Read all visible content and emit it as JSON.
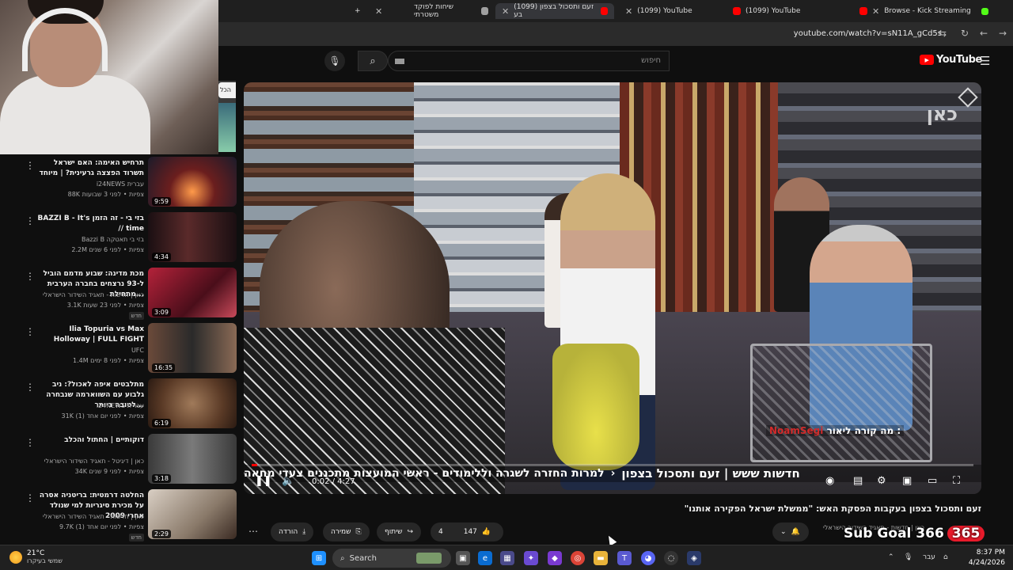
{
  "browser": {
    "tabs": [
      {
        "label": "שיחות לפוקד משטרתי",
        "fav_color": "#a0a0a0"
      },
      {
        "label": "(1099) זעם ותסכול בצפון בע",
        "fav_color": "#ff0000"
      },
      {
        "label": "(1099) YouTube",
        "fav_color": "#ff0000"
      },
      {
        "label": "(1099) YouTube",
        "fav_color": "#ff0000"
      },
      {
        "label": "Browse - Kick Streaming",
        "fav_color": "#53fc18"
      }
    ],
    "new_tab": "+",
    "url": "youtube.com/watch?v=sN11A_gCd5s"
  },
  "youtube": {
    "search_placeholder": "חיפוש",
    "logo_text": "YouTube",
    "chip_label": "הכל",
    "recommendations": [
      {
        "title": "תרחיש האימה: האם ישראל תשרוד הפצצה גרעינית? | מיוחד",
        "channel": "i24NEWS עברית",
        "meta": "88K צפיות • לפני 3 שבועות",
        "duration": "9:59",
        "new": "",
        "thumb": "#6b1e1e"
      },
      {
        "title": "BAZZI B - It's בזי בי - זה הזמן // time",
        "channel": "Bazzi B בזי בי תאטקה",
        "meta": "2.2M צפיות • לפני 6 שנים",
        "duration": "4:34",
        "new": "",
        "thumb": "#2a1418"
      },
      {
        "title": "מכת מדינה: שבוע מדמם הוביל ל-93 נרצחים בחברה הערבית מתחילת...",
        "channel": "כאן | חדשות - תאגיד השידור הישראלי",
        "meta": "3.1K צפיות • לפני 23 שעות",
        "duration": "3:09",
        "new": "חדש",
        "thumb": "#8a1b2b"
      },
      {
        "title": "Ilia Topuria vs Max Holloway | FULL FIGHT",
        "channel": "UFC",
        "meta": "1.4M צפיות • לפני 8 ימים",
        "duration": "16:35",
        "new": "",
        "thumb": "#4a4036"
      },
      {
        "title": "מתלבטים איפה לאכול?: ניב גלבוע עם השווארמה שנבחרה לטובה ביותר...",
        "channel": "i24NEWS עברית",
        "meta": "31K צפיות • לפני יום אחד (1)",
        "duration": "6:19",
        "new": "",
        "thumb": "#6b4a34"
      },
      {
        "title": "דוקותיים | החתול והכלב",
        "channel": "כאן | דיגיטל - תאגיד השידור הישראלי",
        "meta": "34K צפיות • לפני 9 שנים",
        "duration": "3:18",
        "new": "",
        "thumb": "#5b5b5b"
      },
      {
        "title": "החלטה דרמטית: בריטניה אסרה על מכירת סיגריות למי שנולד אחרי 2009",
        "channel": "כאן | חדשות - תאגיד השידור הישראלי",
        "meta": "9.7K צפיות • לפני יום אחד (1)",
        "duration": "2:29",
        "new": "חדש",
        "thumb": "#a08a7a"
      }
    ],
    "player": {
      "watermark": "כאן",
      "caption_name": "NoamSegi",
      "caption_text": "מה קורה ליאור :",
      "ticker_bold": "חדשות ששש | זעם ותסכול בצפון",
      "ticker_text": "למרות החזרה לשגרה וללימודים - ראשי המועצות מתכננים צעדי מחאה",
      "time": "0:02 / 4:27",
      "progress": 0.008
    },
    "video_title": "זעם ותסכול בצפון בעקבות הפסקת האש: \"ממשלת ישראל הפקירה אותנו\"",
    "channel_line": "כאן | חדשות - תאגיד השידור הישראלי",
    "actions": {
      "likes": "147",
      "dislikes": "4",
      "share": "שיתוף",
      "save": "שמירה",
      "download": "הורדה"
    }
  },
  "overlay": {
    "subgoal_label": "Sub Goal 366",
    "subgoal_target": "365"
  },
  "taskbar": {
    "temp": "21°C",
    "weather": "שמשי בעיקרו",
    "search": "Search",
    "lang": "עבר",
    "time": "8:37 PM",
    "date": "4/24/2026"
  }
}
